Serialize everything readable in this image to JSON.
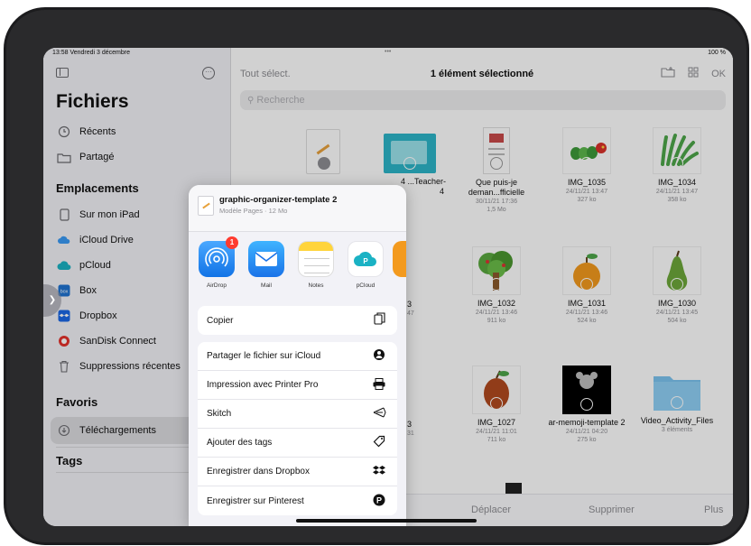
{
  "status": {
    "time": "13:58  Vendredi 3 décembre",
    "dots": "•••",
    "battery": "100 %"
  },
  "sidebar": {
    "title": "Fichiers",
    "top_items": [
      {
        "label": "Récents",
        "icon": "clock-icon"
      },
      {
        "label": "Partagé",
        "icon": "shared-folder-icon"
      }
    ],
    "locations_header": "Emplacements",
    "locations": [
      {
        "label": "Sur mon iPad",
        "icon": "ipad-icon"
      },
      {
        "label": "iCloud Drive",
        "icon": "icloud-icon"
      },
      {
        "label": "pCloud",
        "icon": "pcloud-icon"
      },
      {
        "label": "Box",
        "icon": "box-icon"
      },
      {
        "label": "Dropbox",
        "icon": "dropbox-icon"
      },
      {
        "label": "SanDisk Connect",
        "icon": "sandisk-icon"
      },
      {
        "label": "Suppressions récentes",
        "icon": "trash-icon"
      }
    ],
    "favorites_header": "Favoris",
    "favorites": [
      {
        "label": "Téléchargements",
        "icon": "download-icon"
      }
    ],
    "tags_header": "Tags"
  },
  "main": {
    "select_all": "Tout sélect.",
    "title": "1 élément sélectionné",
    "ok": "OK",
    "search_placeholder": "Recherche",
    "files": [
      {
        "name": "Que puis-je deman...fficielle",
        "date": "30/11/21 17:36",
        "size": "1,5 Mo"
      },
      {
        "name": "IMG_1035",
        "date": "24/11/21 13:47",
        "size": "327 ko"
      },
      {
        "name": "IMG_1034",
        "date": "24/11/21 13:47",
        "size": "358 ko"
      },
      {
        "name": "IMG_1032",
        "date": "24/11/21 13:46",
        "size": "911 ko"
      },
      {
        "name": "IMG_1031",
        "date": "24/11/21 13:46",
        "size": "524 ko"
      },
      {
        "name": "IMG_1030",
        "date": "24/11/21 13:45",
        "size": "504 ko"
      },
      {
        "name": "IMG_1027",
        "date": "24/11/21 11:01",
        "size": "711 ko"
      },
      {
        "name": "ar-memoji-template 2",
        "date": "24/11/21 04:20",
        "size": "275 ko"
      },
      {
        "name": "Video_Activity_Files",
        "date": "",
        "size": "3 éléments"
      }
    ],
    "partial_labels": {
      "teacher": "4 ...Teacher-",
      "teacher2": "4",
      "b1": "3",
      "b1meta": "47",
      "b2": "3",
      "b2meta": "31"
    },
    "toolbar": {
      "move": "Déplacer",
      "delete": "Supprimer",
      "more": "Plus"
    }
  },
  "share_sheet": {
    "doc_title": "graphic-organizer-template 2",
    "doc_sub": "Modèle Pages · 12 Mo",
    "apps": [
      {
        "label": "AirDrop",
        "icon": "airdrop-icon",
        "badge": "1"
      },
      {
        "label": "Mail",
        "icon": "mail-icon"
      },
      {
        "label": "Notes",
        "icon": "notes-icon"
      },
      {
        "label": "pCloud",
        "icon": "pcloud-icon"
      }
    ],
    "copy": "Copier",
    "actions": [
      {
        "label": "Partager le fichier sur iCloud",
        "icon": "icloud-share-icon"
      },
      {
        "label": "Impression avec Printer Pro",
        "icon": "printer-icon"
      },
      {
        "label": "Skitch",
        "icon": "skitch-icon"
      },
      {
        "label": "Ajouter des tags",
        "icon": "tag-icon"
      },
      {
        "label": "Enregistrer dans Dropbox",
        "icon": "dropbox-icon"
      },
      {
        "label": "Enregistrer sur Pinterest",
        "icon": "pinterest-icon"
      }
    ]
  },
  "colors": {
    "accent": "#0a84ff",
    "sidebar_bg": "#f2f2f7",
    "sheet_bg": "#f2f2f7"
  }
}
